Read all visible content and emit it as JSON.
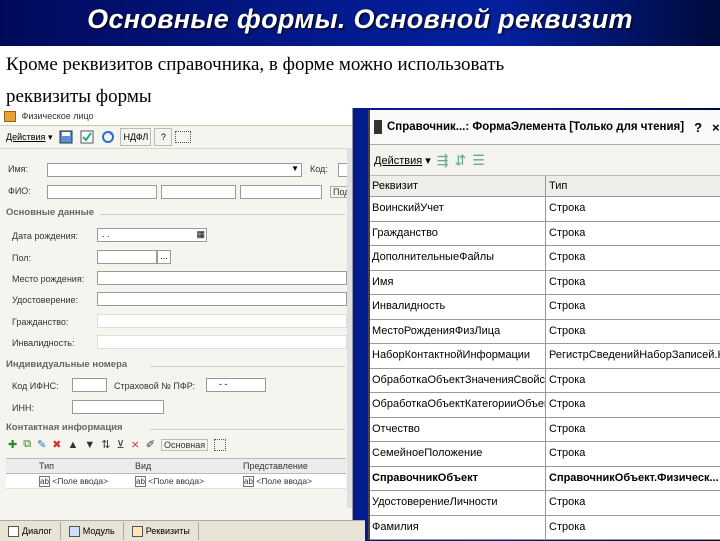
{
  "slide": {
    "title": "Основные формы. Основной реквизит",
    "text_line1": "Кроме реквизитов справочника, в форме можно использовать",
    "text_line2": "реквизиты формы"
  },
  "left_form": {
    "title": "Физическое лицо",
    "toolbar": {
      "actions": "Действия",
      "ndfl": "НДФЛ",
      "help": "?"
    },
    "fields": {
      "name_label": "Имя:",
      "code_label": "Код:",
      "fio_label": "ФИО:",
      "pod_label": "Под",
      "birth_date_label": "Дата рождения:",
      "birth_date_value": ". .",
      "gender_label": "Пол:",
      "birthplace_label": "Место рождения:",
      "id_doc_label": "Удостоверение:",
      "citizenship_label": "Гражданство:",
      "disability_label": "Инвалидность:",
      "ifns_label": "Код ИФНС:",
      "pfr_label": "Страховой № ПФР:",
      "pfr_value": "-  -",
      "inn_label": "ИНН:"
    },
    "sections": {
      "main": "Основные данные",
      "numbers": "Индивидуальные номера",
      "contacts": "Контактная информация"
    },
    "contacts_toolbar": {
      "main": "Основная"
    },
    "table": {
      "columns": [
        "Тип",
        "Вид",
        "Представление"
      ],
      "rows": [
        [
          "<Поле ввода>",
          "<Поле ввода>",
          "<Поле ввода>"
        ]
      ]
    },
    "ellipsis": "..."
  },
  "taskbar": {
    "items": [
      "Диалог",
      "Модуль",
      "Реквизиты"
    ]
  },
  "right_form": {
    "title": "Справочник...: ФормаЭлемента [Только для чтения]",
    "controls": {
      "help": "?",
      "close": "×"
    },
    "toolbar": {
      "actions": "Действия"
    },
    "columns": {
      "attr": "Реквизит",
      "type": "Тип"
    },
    "rows": [
      {
        "attr": "ВоинскийУчет",
        "type": "Строка"
      },
      {
        "attr": "Гражданство",
        "type": "Строка"
      },
      {
        "attr": "ДополнительныеФайлы",
        "type": "Строка"
      },
      {
        "attr": "Имя",
        "type": "Строка"
      },
      {
        "attr": "Инвалидность",
        "type": "Строка"
      },
      {
        "attr": "МестоРожденияФизЛица",
        "type": "Строка"
      },
      {
        "attr": "НаборКонтактнойИнформации",
        "type": "РегистрСведенийНаборЗаписей.Ко..."
      },
      {
        "attr": "ОбработкаОбъектЗначенияСвойств",
        "type": "Строка"
      },
      {
        "attr": "ОбработкаОбъектКатегорииОбъекта",
        "type": "Строка"
      },
      {
        "attr": "Отчество",
        "type": "Строка"
      },
      {
        "attr": "СемейноеПоложение",
        "type": "Строка"
      },
      {
        "attr": "СправочникОбъект",
        "type": "СправочникОбъект.Физическ...",
        "bold": true
      },
      {
        "attr": "УдостоверениеЛичности",
        "type": "Строка"
      },
      {
        "attr": "Фамилия",
        "type": "Строка"
      }
    ]
  }
}
